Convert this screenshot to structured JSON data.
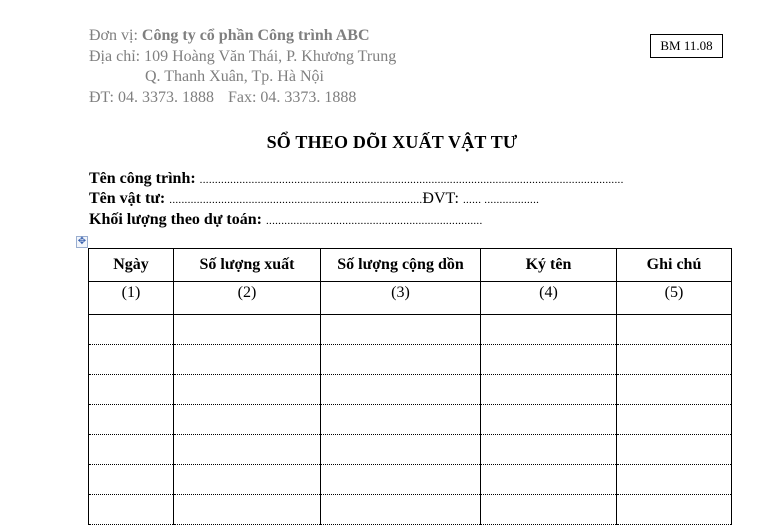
{
  "header": {
    "unit_label": "Đơn vị: ",
    "unit_name": "Công ty cổ phần Công trình ABC",
    "address_line1": "Địa chỉ: 109 Hoàng Văn Thái, P. Khương Trung",
    "address_line2": "Q. Thanh Xuân, Tp. Hà Nội",
    "phone": "ĐT: 04. 3373. 1888",
    "fax": "Fax: 04. 3373. 1888"
  },
  "form_code": "BM 11.08",
  "title": "SỔ THEO DÕI XUẤT VẬT TƯ",
  "fields": {
    "project_label": "Tên công trình:",
    "project_value": "...........................................................................................................................................",
    "material_label": "Tên vật tư:",
    "material_value": "...................................................................................",
    "unit_label": "ĐVT:",
    "unit_value": "...... ..................",
    "estimate_label": "Khối lượng theo dự toán:",
    "estimate_value": "......................................................................."
  },
  "table": {
    "columns": [
      "Ngày",
      "Số lượng xuất",
      "Số lượng cộng dồn",
      "Ký tên",
      "Ghi chú"
    ],
    "column_numbers": [
      "(1)",
      "(2)",
      "(3)",
      "(4)",
      "(5)"
    ],
    "blank_rows": 7
  }
}
